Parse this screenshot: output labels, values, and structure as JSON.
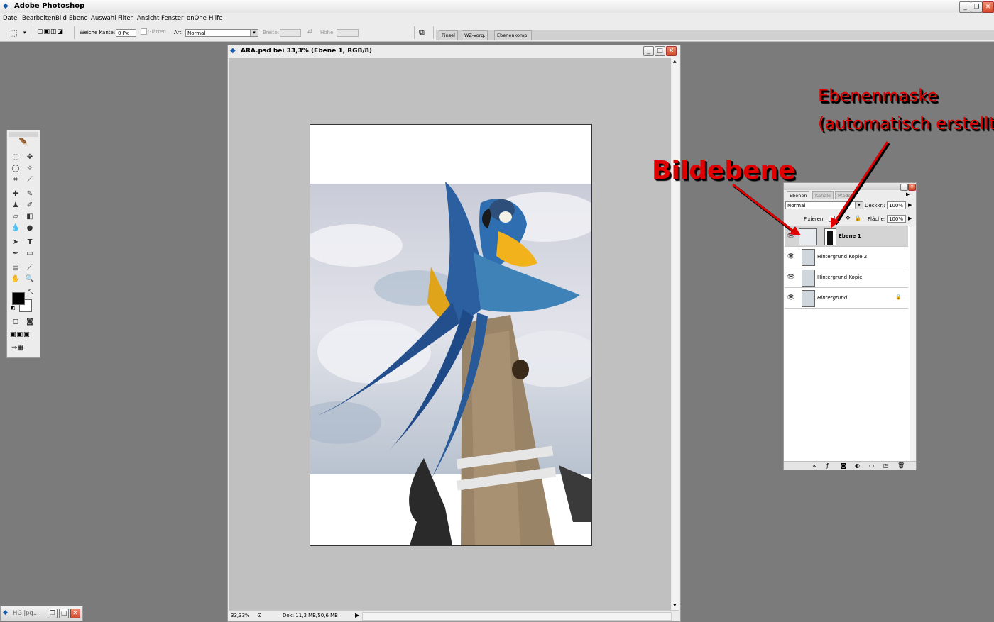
{
  "app": {
    "title": "Adobe Photoshop"
  },
  "menu": [
    "Datei",
    "Bearbeiten",
    "Bild",
    "Ebene",
    "Auswahl",
    "Filter",
    "Ansicht",
    "Fenster",
    "onOne",
    "Hilfe"
  ],
  "options": {
    "feather_label": "Weiche Kante:",
    "feather_value": "0 Px",
    "antialias_label": "Glätten",
    "style_label": "Art:",
    "style_value": "Normal",
    "width_label": "Breite:",
    "height_label": "Höhe:"
  },
  "dock_tabs": [
    "Pinsel",
    "WZ-Vorg.",
    "Ebenenkomp."
  ],
  "document": {
    "title": "ARA.psd bei 33,3% (Ebene 1, RGB/8)",
    "zoom": "33,33%",
    "doc_info": "Dok: 11,3 MB/50,6 MB"
  },
  "layers_panel": {
    "tabs": [
      "Ebenen",
      "Kanäle",
      "Pfade"
    ],
    "blend_mode": "Normal",
    "opacity_label": "Deckkr.:",
    "opacity_value": "100%",
    "lock_label": "Fixieren:",
    "fill_label": "Fläche:",
    "fill_value": "100%",
    "layers": [
      {
        "name": "Ebene 1",
        "selected": true
      },
      {
        "name": "Hintergrund Kopie 2",
        "selected": false
      },
      {
        "name": "Hintergrund Kopie",
        "selected": false
      },
      {
        "name": "Hintergrund",
        "selected": false
      }
    ]
  },
  "annotations": {
    "layer_mask_line1": "Ebenenmaske",
    "layer_mask_line2": "(automatisch erstellt!)",
    "image_layer": "Bildebene"
  },
  "taskbar": {
    "minimized_doc": "HG.jpg..."
  },
  "colors": {
    "annotation_red": "#e00000",
    "workspace": "#7b7b7b",
    "canvas_bg": "#c0c0c0"
  }
}
